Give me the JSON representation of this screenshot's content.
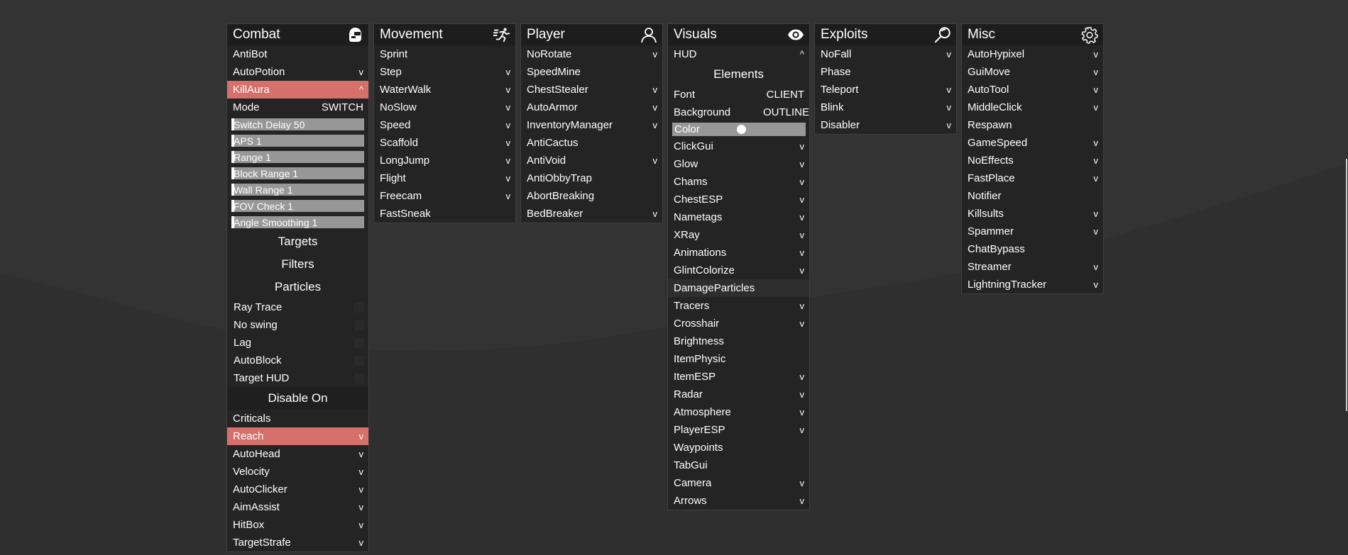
{
  "panels": {
    "combat": {
      "title": "Combat",
      "icon": "helmet-icon",
      "items": {
        "antibot": {
          "label": "AntiBot",
          "chev": ""
        },
        "autopotion": {
          "label": "AutoPotion",
          "chev": "v"
        },
        "killaura": {
          "label": "KillAura",
          "chev": "^"
        }
      },
      "mode": {
        "label": "Mode",
        "value": "SWITCH"
      },
      "sliders": [
        {
          "label": "Switch Delay 50",
          "fill": 0.02
        },
        {
          "label": "APS 1",
          "fill": 0.02
        },
        {
          "label": "Range 1",
          "fill": 0.02
        },
        {
          "label": "Block Range 1",
          "fill": 0.02
        },
        {
          "label": "Wall Range 1",
          "fill": 0.02
        },
        {
          "label": "FOV Check 1",
          "fill": 0.02
        },
        {
          "label": "Angle Smoothing 1",
          "fill": 0.02
        }
      ],
      "sections": {
        "targets": "Targets",
        "filters": "Filters",
        "particles": "Particles",
        "disable_on": "Disable On"
      },
      "checkboxes": [
        "Ray Trace",
        "No swing",
        "Lag",
        "AutoBlock",
        "Target HUD"
      ],
      "modules": [
        {
          "label": "Criticals",
          "chev": ""
        },
        {
          "label": "Reach",
          "chev": "v"
        },
        {
          "label": "AutoHead",
          "chev": "v"
        },
        {
          "label": "Velocity",
          "chev": "v"
        },
        {
          "label": "AutoClicker",
          "chev": "v"
        },
        {
          "label": "AimAssist",
          "chev": "v"
        },
        {
          "label": "HitBox",
          "chev": "v"
        },
        {
          "label": "TargetStrafe",
          "chev": "v"
        }
      ]
    },
    "movement": {
      "title": "Movement",
      "icon": "running-icon",
      "items": [
        {
          "label": "Sprint",
          "chev": ""
        },
        {
          "label": "Step",
          "chev": "v"
        },
        {
          "label": "WaterWalk",
          "chev": "v"
        },
        {
          "label": "NoSlow",
          "chev": "v"
        },
        {
          "label": "Speed",
          "chev": "v"
        },
        {
          "label": "Scaffold",
          "chev": "v"
        },
        {
          "label": "LongJump",
          "chev": "v"
        },
        {
          "label": "Flight",
          "chev": "v"
        },
        {
          "label": "Freecam",
          "chev": "v"
        },
        {
          "label": "FastSneak",
          "chev": ""
        }
      ]
    },
    "player": {
      "title": "Player",
      "icon": "user-icon",
      "items": [
        {
          "label": "NoRotate",
          "chev": "v"
        },
        {
          "label": "SpeedMine",
          "chev": ""
        },
        {
          "label": "ChestStealer",
          "chev": "v"
        },
        {
          "label": "AutoArmor",
          "chev": "v"
        },
        {
          "label": "InventoryManager",
          "chev": "v"
        },
        {
          "label": "AntiCactus",
          "chev": ""
        },
        {
          "label": "AntiVoid",
          "chev": "v"
        },
        {
          "label": "AntiObbyTrap",
          "chev": ""
        },
        {
          "label": "AbortBreaking",
          "chev": ""
        },
        {
          "label": "BedBreaker",
          "chev": "v"
        }
      ]
    },
    "visuals": {
      "title": "Visuals",
      "icon": "eye-icon",
      "hud": {
        "label": "HUD",
        "chev": "^"
      },
      "elements_label": "Elements",
      "font": {
        "label": "Font",
        "value": "CLIENT"
      },
      "background": {
        "label": "Background",
        "value": "OUTLINE"
      },
      "color": {
        "label": "Color"
      },
      "items": [
        {
          "label": "ClickGui",
          "chev": "v"
        },
        {
          "label": "Glow",
          "chev": "v"
        },
        {
          "label": "Chams",
          "chev": "v"
        },
        {
          "label": "ChestESP",
          "chev": "v"
        },
        {
          "label": "Nametags",
          "chev": "v"
        },
        {
          "label": "XRay",
          "chev": "v"
        },
        {
          "label": "Animations",
          "chev": "v"
        },
        {
          "label": "GlintColorize",
          "chev": "v"
        },
        {
          "label": "DamageParticles",
          "chev": ""
        },
        {
          "label": "Tracers",
          "chev": "v"
        },
        {
          "label": "Crosshair",
          "chev": "v"
        },
        {
          "label": "Brightness",
          "chev": ""
        },
        {
          "label": "ItemPhysic",
          "chev": ""
        },
        {
          "label": "ItemESP",
          "chev": "v"
        },
        {
          "label": "Radar",
          "chev": "v"
        },
        {
          "label": "Atmosphere",
          "chev": "v"
        },
        {
          "label": "PlayerESP",
          "chev": "v"
        },
        {
          "label": "Waypoints",
          "chev": ""
        },
        {
          "label": "TabGui",
          "chev": ""
        },
        {
          "label": "Camera",
          "chev": "v"
        },
        {
          "label": "Arrows",
          "chev": "v"
        }
      ]
    },
    "exploits": {
      "title": "Exploits",
      "icon": "magnifier-icon",
      "items": [
        {
          "label": "NoFall",
          "chev": "v"
        },
        {
          "label": "Phase",
          "chev": ""
        },
        {
          "label": "Teleport",
          "chev": "v"
        },
        {
          "label": "Blink",
          "chev": "v"
        },
        {
          "label": "Disabler",
          "chev": "v"
        }
      ]
    },
    "misc": {
      "title": "Misc",
      "icon": "gear-icon",
      "items": [
        {
          "label": "AutoHypixel",
          "chev": "v"
        },
        {
          "label": "GuiMove",
          "chev": "v"
        },
        {
          "label": "AutoTool",
          "chev": "v"
        },
        {
          "label": "MiddleClick",
          "chev": "v"
        },
        {
          "label": "Respawn",
          "chev": ""
        },
        {
          "label": "GameSpeed",
          "chev": "v"
        },
        {
          "label": "NoEffects",
          "chev": "v"
        },
        {
          "label": "FastPlace",
          "chev": "v"
        },
        {
          "label": "Notifier",
          "chev": ""
        },
        {
          "label": "Killsults",
          "chev": "v"
        },
        {
          "label": "Spammer",
          "chev": "v"
        },
        {
          "label": "ChatBypass",
          "chev": ""
        },
        {
          "label": "Streamer",
          "chev": "v"
        },
        {
          "label": "LightningTracker",
          "chev": "v"
        }
      ]
    }
  },
  "colors": {
    "background": "#333333",
    "panel": "#242424",
    "header": "#1d1d1d",
    "active": "#d5706b",
    "slider_track": "#979797"
  }
}
